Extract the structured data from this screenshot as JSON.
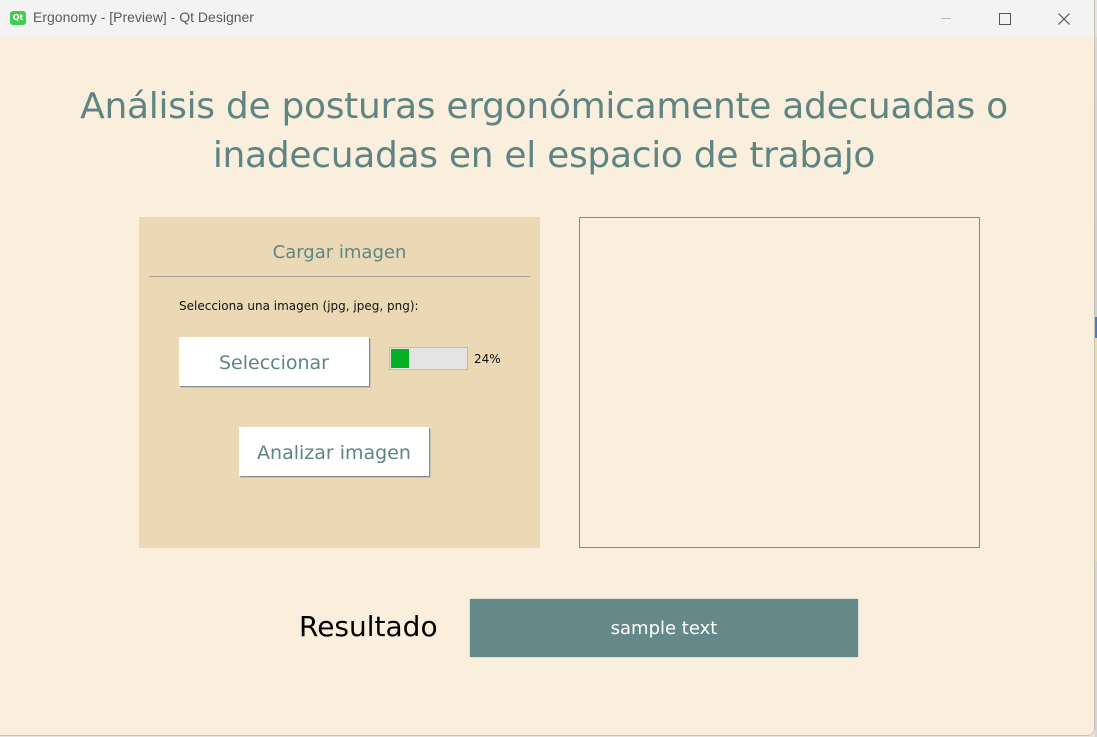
{
  "window": {
    "title": "Ergonomy - [Preview] - Qt Designer",
    "icon": "qt-designer-icon",
    "icon_text": "Qt",
    "controls": [
      "minimize-icon",
      "maximize-icon",
      "close-icon"
    ]
  },
  "heading": {
    "line1": "Análisis de posturas ergonómicamente adecuadas o",
    "line2": "inadecuadas en el espacio de trabajo"
  },
  "upload_panel": {
    "title": "Cargar imagen",
    "instruction": "Selecciona una imagen (jpg, jpeg, png):",
    "select_button": "Seleccionar",
    "progress": {
      "value": 24,
      "label": "24%"
    },
    "analyze_button": "Analizar imagen"
  },
  "image_preview": {},
  "result": {
    "label": "Resultado",
    "value": "sample text"
  },
  "colors": {
    "window_bg": "#faefdc",
    "panel_bg": "#ebd9b5",
    "accent_text": "#5e8584",
    "result_bg": "#648988",
    "progress_fill": "#06b025"
  }
}
